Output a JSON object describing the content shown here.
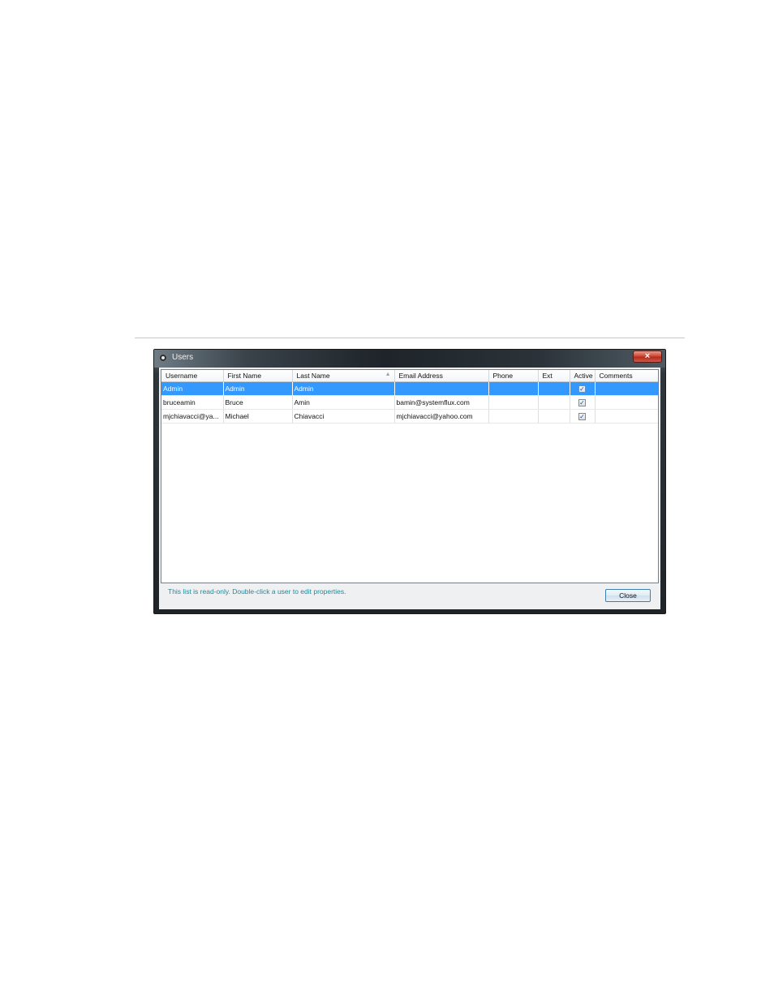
{
  "window": {
    "title": "Users",
    "close_glyph": "×"
  },
  "table": {
    "columns": [
      "Username",
      "First Name",
      "Last Name",
      "Email Address",
      "Phone",
      "Ext",
      "Active",
      "Comments"
    ],
    "sorted_column": "Last Name",
    "rows": [
      {
        "username": "Admin",
        "first_name": "Admin",
        "last_name": "Admin",
        "email": "",
        "phone": "",
        "ext": "",
        "active": true,
        "comments": "",
        "selected": true
      },
      {
        "username": "bruceamin",
        "first_name": "Bruce",
        "last_name": "Amin",
        "email": "bamin@systemflux.com",
        "phone": "",
        "ext": "",
        "active": true,
        "comments": "",
        "selected": false
      },
      {
        "username": "mjchiavacci@ya...",
        "first_name": "Michael",
        "last_name": "Chiavacci",
        "email": "mjchiavacci@yahoo.com",
        "phone": "",
        "ext": "",
        "active": true,
        "comments": "",
        "selected": false
      }
    ]
  },
  "footer": {
    "hint": "This list is read-only.  Double-click a user to edit properties.",
    "close_label": "Close"
  },
  "icons": {
    "window_icon": "users-window-icon",
    "sort_indicator": "sort-ascending-icon",
    "checkmark": "checkmark-icon"
  },
  "colors": {
    "selection": "#3399ff",
    "hint_text": "#1f8a9c"
  }
}
